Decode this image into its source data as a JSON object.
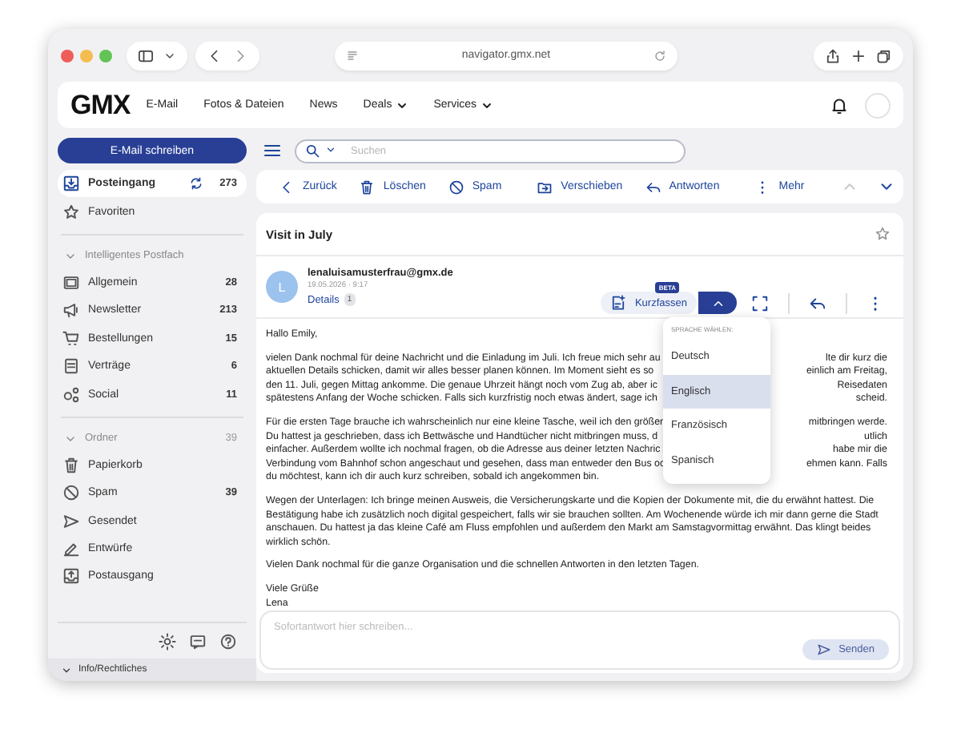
{
  "browser": {
    "url": "navigator.gmx.net"
  },
  "header": {
    "logo": "GMX",
    "nav": [
      {
        "label": "E-Mail",
        "dropdown": false
      },
      {
        "label": "Fotos & Dateien",
        "dropdown": false
      },
      {
        "label": "News",
        "dropdown": false
      },
      {
        "label": "Deals",
        "dropdown": true
      },
      {
        "label": "Services",
        "dropdown": true
      }
    ]
  },
  "compose_button": "E-Mail schreiben",
  "search": {
    "placeholder": "Suchen"
  },
  "sidebar": {
    "items": [
      {
        "label": "Posteingang",
        "count": "273",
        "selected": true
      },
      {
        "label": "Favoriten",
        "selected": false
      }
    ],
    "groups": [
      {
        "title": "Intelligentes Postfach",
        "expanded": true,
        "items": [
          {
            "label": "Allgemein",
            "count": "28",
            "selected": false
          },
          {
            "label": "Newsletter",
            "count": "213",
            "selected": false
          },
          {
            "label": "Bestellungen",
            "count": "15",
            "selected": false
          },
          {
            "label": "Verträge",
            "count": "6",
            "selected": false
          },
          {
            "label": "Social",
            "count": "11",
            "selected": false
          }
        ]
      },
      {
        "title": "Ordner",
        "count": "39",
        "expanded": true,
        "items": [
          {
            "label": "Papierkorb",
            "selected": false
          },
          {
            "label": "Spam",
            "count": "39",
            "selected": false
          },
          {
            "label": "Gesendet",
            "selected": false
          },
          {
            "label": "Entwürfe",
            "selected": false
          },
          {
            "label": "Postausgang",
            "selected": false
          }
        ]
      }
    ],
    "footer": "Info/Rechtliches"
  },
  "toolbar": {
    "actions": [
      {
        "label": "Zurück"
      },
      {
        "label": "Löschen"
      },
      {
        "label": "Spam"
      },
      {
        "label": "Verschieben"
      },
      {
        "label": "Antworten"
      },
      {
        "label": "Mehr"
      }
    ],
    "pager": [
      {
        "disabled": true
      },
      {
        "disabled": false
      }
    ]
  },
  "message": {
    "subject": "Visit in July",
    "avatar": "L",
    "sender": "lenaluisamusterfrau@gmx.de",
    "date": "19.05.2026 · 9:17",
    "details": "Details",
    "details_count": "1",
    "summary_button": "Kurzfassen",
    "summary_badge": "BETA",
    "language_menu": {
      "expanded": true,
      "title": "SPRACHE WÄHLEN:",
      "options": [
        {
          "label": "Deutsch",
          "selected": false
        },
        {
          "label": "Englisch",
          "selected": true
        },
        {
          "label": "Französisch",
          "selected": false
        },
        {
          "label": "Spanisch",
          "selected": false
        }
      ]
    },
    "greeting": "Hallo Emily,",
    "paragraphs": [
      {
        "lines": [
          {
            "left": "vielen Dank nochmal für deine Nachricht und die Einladung im Juli. Ich freue mich sehr au",
            "right": "lte dir kurz die"
          },
          {
            "left": "aktuellen Details schicken, damit wir alles besser planen können. Im Moment sieht es so",
            "right": "einlich am Freitag,"
          },
          {
            "left": "den 11. Juli, gegen Mittag ankomme. Die genaue Uhrzeit hängt noch vom Zug ab, aber ic",
            "right": "Reisedaten"
          },
          {
            "left": "spätestens Anfang der Woche schicken. Falls sich kurzfristig noch etwas ändert, sage ich",
            "right": "scheid."
          }
        ]
      },
      {
        "lines": [
          {
            "left": "Für die ersten Tage brauche ich wahrscheinlich nur eine kleine Tasche, weil ich den größer",
            "right": "mitbringen werde."
          },
          {
            "left": "Du hattest ja geschrieben, dass ich Bettwäsche und Handtücher nicht mitbringen muss, d",
            "right": "utlich"
          },
          {
            "left": "einfacher. Außerdem wollte ich nochmal fragen, ob die Adresse aus deiner letzten Nachric",
            "right": "habe mir die"
          },
          {
            "left": "Verbindung vom Bahnhof schon angeschaut und gesehen, dass man entweder den Bus oc",
            "right": "ehmen kann. Falls"
          },
          {
            "left": "du möchtest, kann ich dir auch kurz schreiben, sobald ich angekommen bin."
          }
        ]
      },
      {
        "text": "Wegen der Unterlagen: Ich bringe meinen Ausweis, die Versicherungskarte und die Kopien der Dokumente mit, die du erwähnt hattest. Die Bestätigung habe ich zusätzlich noch digital gespeichert, falls wir sie brauchen sollten. Am Wochenende würde ich mir dann gerne die Stadt anschauen. Du hattest ja das kleine Café am Fluss empfohlen und außerdem den Markt am Samstagvormittag erwähnt. Das klingt beides wirklich schön."
      },
      {
        "text": "Vielen Dank nochmal für die ganze Organisation und die schnellen Antworten in den letzten Tagen."
      }
    ],
    "closing": [
      "Viele Grüße",
      "Lena"
    ]
  },
  "reply": {
    "placeholder": "Sofortantwort hier schreiben...",
    "send_button": "Senden",
    "send_disabled": true
  }
}
